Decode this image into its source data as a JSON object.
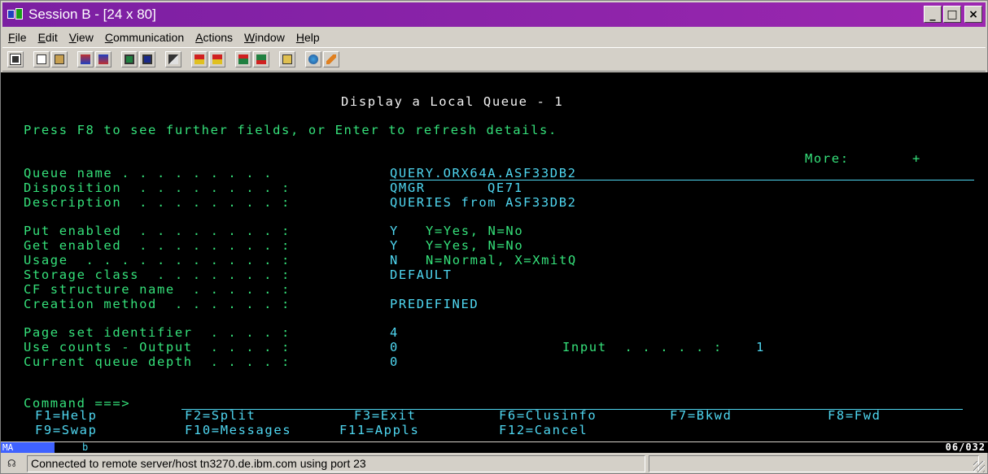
{
  "window": {
    "title": "Session B - [24 x 80]",
    "controls": {
      "minimize": "_",
      "maximize": "□",
      "close": "×"
    }
  },
  "menu": [
    "File",
    "Edit",
    "View",
    "Communication",
    "Actions",
    "Window",
    "Help"
  ],
  "toolbar_icons": [
    "print-screen-icon",
    "copy-icon",
    "paste-icon",
    "send-file-icon",
    "receive-file-icon",
    "display-setup-icon",
    "font-icon",
    "color-map-icon",
    "record-macro-icon",
    "play-macro-icon",
    "stop-macro-icon",
    "run-macro-icon",
    "clipboard-icon",
    "help-globe-icon",
    "edit-icon"
  ],
  "screen": {
    "title": "Display a Local Queue - 1",
    "instruction": "Press F8 to see further fields, or Enter to refresh details.",
    "more_label": "More:",
    "more_indicator": "+",
    "fields": [
      {
        "label": "Queue name . . . . . . . . .",
        "value": "QUERY.ORX64A.ASF33DB2",
        "note": ""
      },
      {
        "label": "Disposition  . . . . . . . . :",
        "value": "QMGR",
        "note": "QE71"
      },
      {
        "label": "Description  . . . . . . . . :",
        "value": "QUERIES from ASF33DB2",
        "note": ""
      },
      {
        "label": "Put enabled  . . . . . . . . :",
        "value": "Y",
        "note": "Y=Yes, N=No"
      },
      {
        "label": "Get enabled  . . . . . . . . :",
        "value": "Y",
        "note": "Y=Yes, N=No"
      },
      {
        "label": "Usage  . . . . . . . . . . . :",
        "value": "N",
        "note": "N=Normal, X=XmitQ"
      },
      {
        "label": "Storage class  . . . . . . . :",
        "value": "DEFAULT",
        "note": ""
      },
      {
        "label": "CF structure name  . . . . . :",
        "value": "",
        "note": ""
      },
      {
        "label": "Creation method  . . . . . . :",
        "value": "PREDEFINED",
        "note": ""
      },
      {
        "label": "Page set identifier  . . . . :",
        "value": "4",
        "note": ""
      },
      {
        "label": "Use counts - Output  . . . . :",
        "value": "0",
        "note": ""
      },
      {
        "label": "Current queue depth  . . . . :",
        "value": "0",
        "note": ""
      }
    ],
    "input_label": "Input  . . . . . :",
    "input_value": "1",
    "command_label": "Command ===>",
    "fkeys_row1": [
      "F1=Help",
      "F2=Split",
      "F3=Exit",
      "F6=Clusinfo",
      "F7=Bkwd",
      "F8=Fwd"
    ],
    "fkeys_row2": [
      "F9=Swap",
      "F10=Messages",
      "F11=Appls",
      "F12=Cancel"
    ]
  },
  "oia": {
    "indicator": "MA",
    "session": "b",
    "cursor_pos": "06/032"
  },
  "status": {
    "message": "Connected to remote server/host tn3270.de.ibm.com using port 23"
  },
  "colors": {
    "title_bar": "#8e24aa",
    "terminal_bg": "#000000",
    "terminal_green": "#35e07a",
    "terminal_cyan": "#4fd6f0"
  }
}
